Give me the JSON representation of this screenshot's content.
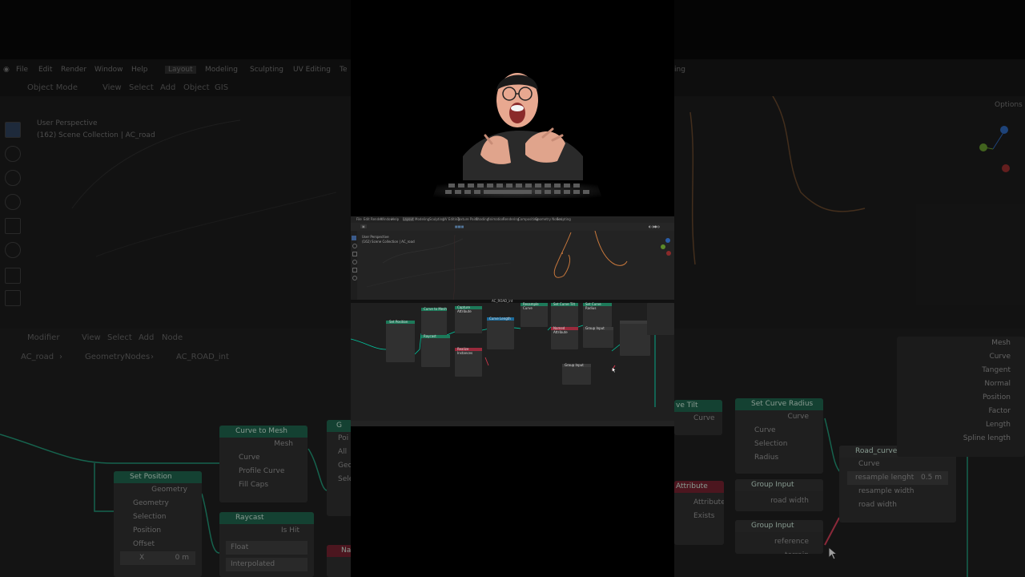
{
  "background": {
    "menu": [
      "File",
      "Edit",
      "Render",
      "Window",
      "Help"
    ],
    "workspaces": [
      "Layout",
      "Modeling",
      "Sculpting",
      "UV Editing",
      "Te"
    ],
    "workspaces_right": "ing",
    "toolbar": [
      "Object Mode",
      "View",
      "Select",
      "Add",
      "Object",
      "GIS"
    ],
    "viewport_info": {
      "perspective": "User Perspective",
      "collection": "(162) Scene Collection | AC_road"
    },
    "options_label": "Options",
    "node_header": [
      "Modifier",
      "View",
      "Select",
      "Add",
      "Node"
    ],
    "breadcrumb": [
      "AC_road",
      "GeometryNodes",
      "AC_ROAD_int"
    ],
    "nodes": {
      "curve_to_mesh": {
        "title": "Curve to Mesh",
        "output": "Mesh",
        "inputs": [
          "Curve",
          "Profile Curve",
          "Fill Caps"
        ]
      },
      "set_position": {
        "title": "Set Position",
        "output": "Geometry",
        "inputs": [
          "Geometry",
          "Selection",
          "Position",
          "Offset"
        ],
        "x_label": "X",
        "x_value": "0 m"
      },
      "raycast": {
        "title": "Raycast",
        "output": "Is Hit",
        "mode1": "Float",
        "mode2": "Interpolated"
      },
      "partial_left": {
        "title": "G",
        "rows": [
          "Poi",
          "All",
          "Geo",
          "Sele"
        ]
      },
      "partial_n": "Na",
      "set_curve_tilt": {
        "title": "ve Tilt",
        "output": "Curve"
      },
      "set_curve_radius": {
        "title": "Set Curve Radius",
        "output": "Curve",
        "inputs": [
          "Curve",
          "Selection",
          "Radius"
        ]
      },
      "named_attribute": {
        "title": "Attribute",
        "outputs": [
          "Attribute",
          "Exists"
        ]
      },
      "group_input_1": {
        "title": "Group Input",
        "output": "road width"
      },
      "group_input_2": {
        "title": "Group Input",
        "output": "reference terrain"
      },
      "road_curve": {
        "title": "Road_curve...",
        "count": "4",
        "inputs": [
          "Curve",
          "resample lenght",
          "resample width",
          "road width"
        ],
        "resample_value": "0.5 m"
      },
      "group_output": {
        "rows": [
          "Mesh",
          "Curve",
          "Tangent",
          "Normal",
          "Position",
          "Factor",
          "Length",
          "Spline length"
        ]
      }
    }
  },
  "center_screenshot": {
    "menu": [
      "File",
      "Edit",
      "Render",
      "Window",
      "Help",
      "Layout",
      "Modeling",
      "Sculpting",
      "UV Editing",
      "Texture Paint",
      "Shading",
      "Animation",
      "Rendering",
      "Compositing",
      "Geometry Nodes",
      "Scripting"
    ],
    "viewport_text": [
      "User Perspective",
      "(162) Scene Collection | AC_road"
    ],
    "node_editor_title": "AC_ROAD_int",
    "nodes": [
      "Set Position",
      "Curve to Mesh",
      "Raycast",
      "Capture Attribute",
      "Curve Length",
      "Resample Curve",
      "Set Curve Tilt",
      "Set Curve Radius",
      "Named Attribute",
      "Group Input",
      "Realize Instances",
      "Group Input"
    ]
  },
  "colors": {
    "node_green": "#1d5a46",
    "node_red": "#6a1f2c",
    "node_blue": "#1b4e6a",
    "socket": "#00c8a0",
    "curve_orange": "#c8783c"
  }
}
